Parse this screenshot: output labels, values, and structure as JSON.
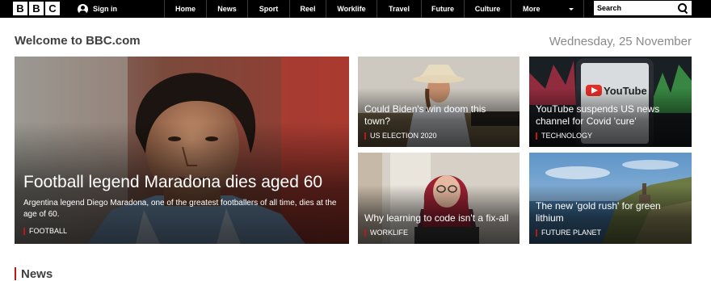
{
  "header": {
    "logo_letters": [
      "B",
      "B",
      "C"
    ],
    "signin_label": "Sign in",
    "nav": [
      "Home",
      "News",
      "Sport",
      "Reel",
      "Worklife",
      "Travel",
      "Future",
      "Culture"
    ],
    "more_label": "More",
    "search_placeholder": "Search"
  },
  "page": {
    "welcome": "Welcome to BBC.com",
    "date": "Wednesday, 25 November"
  },
  "stories": {
    "main": {
      "headline": "Football legend Maradona dies aged 60",
      "summary": "Argentina legend Diego Maradona, one of the greatest footballers of all time, dies at the age of 60.",
      "tag": "FOOTBALL"
    },
    "biden": {
      "headline": "Could Biden's win doom this town?",
      "tag": "US ELECTION 2020"
    },
    "youtube": {
      "headline": "YouTube suspends US news channel for Covid 'cure'",
      "tag": "TECHNOLOGY",
      "screen_text": "YouTube"
    },
    "coding": {
      "headline": "Why learning to code isn't a fix-all",
      "tag": "WORKLIFE"
    },
    "lithium": {
      "headline": "The new 'gold rush' for green lithium",
      "tag": "FUTURE PLANET"
    }
  },
  "section": {
    "news_title": "News"
  },
  "colors": {
    "accent": "#bb1919",
    "topbar": "#000000",
    "heading": "#404040",
    "date": "#8a8a8a"
  }
}
